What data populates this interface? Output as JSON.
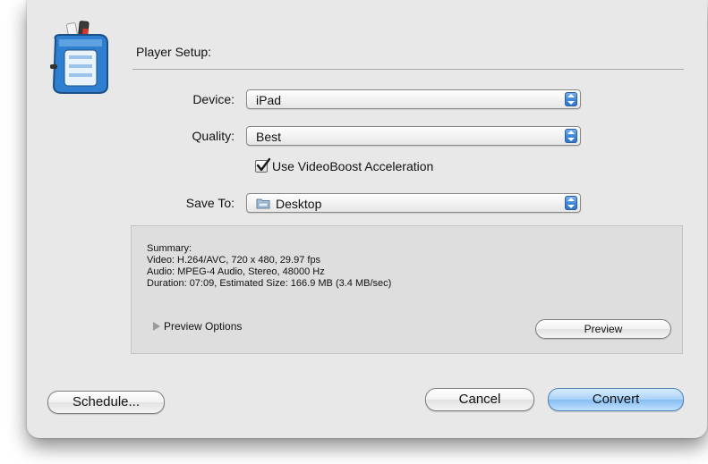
{
  "dialog": {
    "section_title": "Player Setup:",
    "device": {
      "label": "Device:",
      "value": "iPad"
    },
    "quality": {
      "label": "Quality:",
      "value": "Best"
    },
    "videoboost": {
      "label": "Use VideoBoost Acceleration",
      "checked": true
    },
    "save_to": {
      "label": "Save To:",
      "value": "Desktop"
    }
  },
  "summary": {
    "heading": "Summary:",
    "video": "Video: H.264/AVC, 720 x 480, 29.97 fps",
    "audio": "Audio: MPEG-4 Audio, Stereo, 48000 Hz",
    "duration": "Duration: 07:09, Estimated Size: 166.9 MB (3.4 MB/sec)",
    "preview_options": "Preview Options",
    "preview_button": "Preview"
  },
  "buttons": {
    "schedule": "Schedule...",
    "cancel": "Cancel",
    "convert": "Convert"
  },
  "colors": {
    "accent": "#3f86db",
    "default_button": "#86bef2"
  }
}
